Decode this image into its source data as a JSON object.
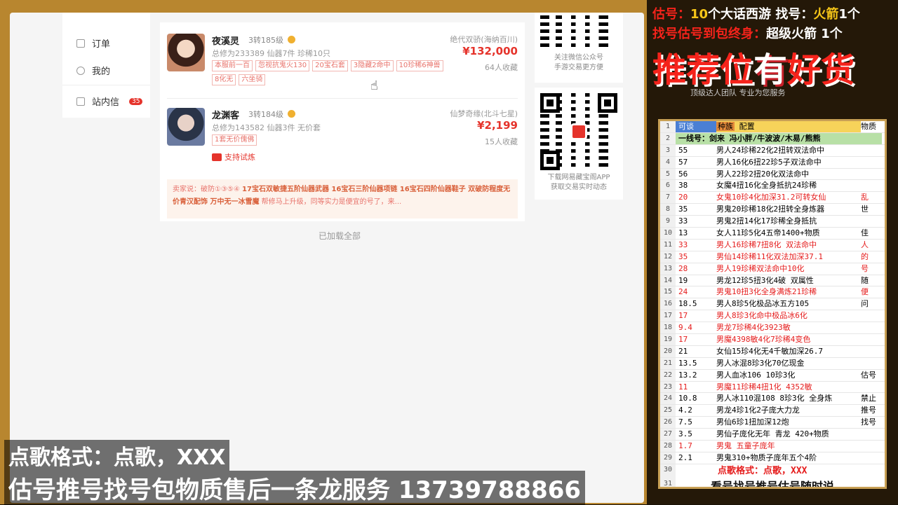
{
  "sidebar": {
    "items": [
      {
        "label": "订单"
      },
      {
        "label": "我的"
      },
      {
        "label": "站内信",
        "badge": "35"
      }
    ]
  },
  "listings": [
    {
      "name": "夜溪灵",
      "level": "3转185级",
      "meta": "总修为233389  仙器7件  珍稀10只",
      "tags": [
        "本服前一百",
        "忽视抗鬼火130",
        "20宝石套",
        "3隐藏2命中",
        "10珍稀6神兽",
        "8化无",
        "六坐骑"
      ],
      "server": "绝代双骄(海纳百川)",
      "price": "¥132,000",
      "fav": "64人收藏"
    },
    {
      "name": "龙渊客",
      "level": "3转184级",
      "meta": "总修为143582  仙器3件  无价套",
      "tags": [
        "1套无价傀佛"
      ],
      "trial": "支持试炼",
      "server": "仙梦奇缘(北斗七星)",
      "price": "¥2,199",
      "fav": "15人收藏"
    }
  ],
  "seller_note": {
    "prefix": "卖家说：",
    "text": "破防①③⑤④ ",
    "highlight": "17宝石双敏捷五阶仙器武器 16宝石三阶仙器项链 16宝石四阶仙器鞋子 双破防程度无价青汉配饰 万中无一冰雪魔",
    "tail": " 帮修马上升级，同等实力是便宜的号了，来..."
  },
  "loaded_text": "已加载全部",
  "qr": [
    {
      "line1": "关注微信公众号",
      "line2": "手游交易更方便"
    },
    {
      "line1": "下载网易藏宝阁APP",
      "line2": "获取交易实时动态"
    }
  ],
  "overlay": {
    "line1": "点歌格式：点歌，XXX",
    "line2": "估号推号找号包物质售后一条龙服务 13739788866"
  },
  "right": {
    "h1_prefix": "估号：",
    "h1_count1": "10",
    "h1_mid": "个大话西游 找号：",
    "h1_item": "火箭",
    "h1_count2": "1个",
    "h2_prefix": "找号估号到包终身：",
    "h2_item": "超级火箭 1个",
    "big_a": "推荐位",
    "big_b": "有",
    "big_c": "好货",
    "tagline": "顶级达人团队  专业为您服务"
  },
  "sheet": {
    "header": [
      "可谈",
      "种族",
      "配置",
      "物质"
    ],
    "row2": "一线号：剑来 冯小胖/牛波波/木易/熊熊",
    "rows": [
      {
        "n": "3",
        "a": "55",
        "b": "男人24珍稀22化2扭转双法命中",
        "c": "",
        "red": false
      },
      {
        "n": "4",
        "a": "57",
        "b": "男人16化6扭22珍5子双法命中",
        "c": "",
        "red": false
      },
      {
        "n": "5",
        "a": "56",
        "b": "男人22珍2扭20化双法命中",
        "c": "",
        "red": false
      },
      {
        "n": "6",
        "a": "38",
        "b": "女魔4扭16化全身抵抗24珍稀",
        "c": "",
        "red": false
      },
      {
        "n": "7",
        "a": "20",
        "b": "女鬼10珍4化加深31.2可转女仙",
        "c": "乱",
        "red": true
      },
      {
        "n": "8",
        "a": "35",
        "b": "男鬼20珍稀18化2扭转全身炼器",
        "c": "世",
        "red": false
      },
      {
        "n": "9",
        "a": "33",
        "b": "男鬼2扭14化17珍稀全身抵抗",
        "c": "",
        "red": false
      },
      {
        "n": "10",
        "a": "13",
        "b": "女人11珍5化4五帝1400+物质",
        "c": "佳",
        "red": false
      },
      {
        "n": "11",
        "a": "33",
        "b": "男人16珍稀7扭8化 双法命中",
        "c": "人",
        "red": true
      },
      {
        "n": "12",
        "a": "35",
        "b": "男仙14珍稀11化双法加深37.1",
        "c": "的",
        "red": true
      },
      {
        "n": "13",
        "a": "28",
        "b": "男人19珍稀双法命中10化",
        "c": "号",
        "red": true
      },
      {
        "n": "14",
        "a": "19",
        "b": "男龙12珍5扭3化4破 双属性",
        "c": "随",
        "red": false
      },
      {
        "n": "15",
        "a": "24",
        "b": "男鬼10扭3化全身满炼21珍稀",
        "c": "便",
        "red": true
      },
      {
        "n": "16",
        "a": "18.5",
        "b": "男人8珍5化极品冰五方105",
        "c": "问",
        "red": false
      },
      {
        "n": "17",
        "a": "17",
        "b": "男人8珍3化命中极品冰6化",
        "c": "",
        "red": true
      },
      {
        "n": "18",
        "a": "9.4",
        "b": "男龙7珍稀4化3923敏",
        "c": "",
        "red": true
      },
      {
        "n": "19",
        "a": "17",
        "b": "男魔4398敏4化7珍稀4变色",
        "c": "",
        "red": true
      },
      {
        "n": "20",
        "a": "21",
        "b": "女仙15珍4化无4千敏加深26.7",
        "c": "",
        "red": false
      },
      {
        "n": "21",
        "a": "13.5",
        "b": "男人冰混8珍3化70亿现金",
        "c": "",
        "red": false
      },
      {
        "n": "22",
        "a": "13.2",
        "b": "男人血冰106 10珍3化",
        "c": "估号",
        "red": false
      },
      {
        "n": "23",
        "a": "11",
        "b": "男魔11珍稀4扭1化 4352敏",
        "c": "",
        "red": true
      },
      {
        "n": "24",
        "a": "10.8",
        "b": "男人冰110混108 8珍3化 全身炼",
        "c": "禁止",
        "red": false
      },
      {
        "n": "25",
        "a": "4.2",
        "b": "男龙4珍1化2子庞大力龙",
        "c": "推号",
        "red": false
      },
      {
        "n": "26",
        "a": "7.5",
        "b": "男仙6珍1扭加深12炮",
        "c": "找号",
        "red": false
      },
      {
        "n": "27",
        "a": "3.5",
        "b": "男仙子庞化无年  青龙 420+物质",
        "c": "",
        "red": false
      },
      {
        "n": "28",
        "a": "1.7",
        "b": "男鬼 五童子庞年",
        "c": "",
        "red": true
      },
      {
        "n": "29",
        "a": "2.1",
        "b": "男鬼310+物质子庞年五个4阶",
        "c": "",
        "red": false
      }
    ],
    "foot": "点歌格式：点歌，XXX",
    "foot2": "看号找号推号估号随时说",
    "phone": "13739788866"
  }
}
